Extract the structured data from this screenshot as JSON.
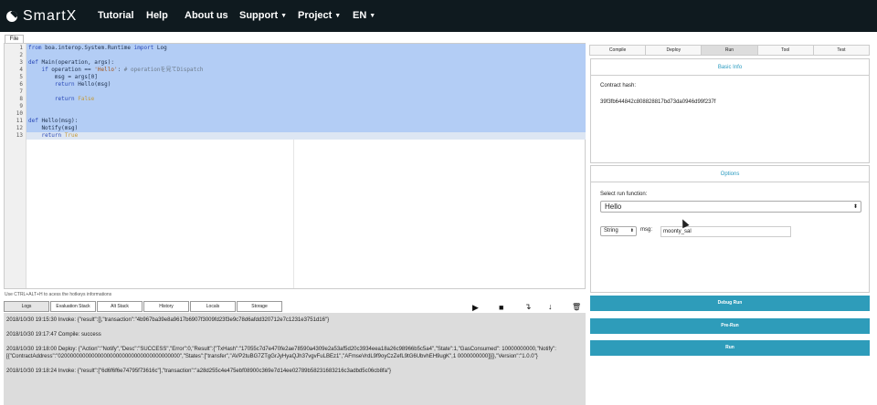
{
  "nav": {
    "brand": "SmartX",
    "items": [
      "Tutorial",
      "Help",
      "About us",
      "Support",
      "Project",
      "EN"
    ]
  },
  "editor": {
    "file_tab": "File",
    "hint": "Use CTRL+ALT+H to acess the hotkeys informations",
    "lines": [
      {
        "n": "1",
        "text": ""
      },
      {
        "n": "2",
        "text": ""
      },
      {
        "n": "3",
        "text": ""
      },
      {
        "n": "4",
        "text": ""
      },
      {
        "n": "5",
        "text": ""
      },
      {
        "n": "6",
        "text": ""
      },
      {
        "n": "7",
        "text": ""
      },
      {
        "n": "8",
        "text": ""
      },
      {
        "n": "9",
        "text": ""
      },
      {
        "n": "10",
        "text": ""
      },
      {
        "n": "11",
        "text": ""
      },
      {
        "n": "12",
        "text": ""
      },
      {
        "n": "13",
        "text": ""
      }
    ]
  },
  "bottom_tabs": [
    "Logs",
    "Evaluation Stack",
    "Alt Stack",
    "History",
    "Locals",
    "Storage"
  ],
  "console": [
    "2018/10/30 19:15:30 Invoke: {\"result\":[],\"transaction\":\"4b967ba39e8a9617b6907f3009fd23f3e9c78d6afdd320712e7c1231e3751d16\"}",
    "2018/10/30 19:17:47 Compile: success",
    "2018/10/30 19:18:00 Deploy: {\"Action\":\"Notify\",\"Desc\":\"SUCCESS\",\"Error\":0,\"Result\":{\"TxHash\":\"17055c7d7e470fe2ae78590a4309e2a53af5d20c3934eea18a26c98966b5c5a4\",\"State\":1,\"GasConsumed\": 10000000000,\"Notify\":[{\"ContractAddress\":\"0200000000000000000000000000000000000000\",\"States\":[\"transfer\",\"AVP2tuBG7ZTgGrJyHyaQJh37vgvFuLBEz1\",\"AFmseVrdL9f9oyCzZefL9tG6UbvhEH9ugK\",1 0000000000]}]},\"Version\":\"1.0.0\"}",
    "2018/10/30 19:18:24 Invoke: {\"result\":[\"6d6f6f6e74795f73616c\"],\"transaction\":\"a28d255c4e475ebf08900c369e7d14ee02789b58231683216c3adbd5c06cb8fa\"}"
  ],
  "right": {
    "tabs": [
      "Compile",
      "Deploy",
      "Run",
      "Tool",
      "Test"
    ],
    "active_tab": "Run",
    "basic_info": {
      "title": "Basic Info",
      "hash_label": "Contract hash:",
      "hash_value": "39f3fb644842c808828817bd73da0946d99f237f"
    },
    "options": {
      "title": "Options",
      "function_label": "Select run function:",
      "function_value": "Hello",
      "param_type": "String",
      "param_label": "msg:",
      "param_value": "moonty_sal"
    },
    "buttons": [
      "Debug Run",
      "Pre-Run",
      "Run"
    ]
  },
  "colors": {
    "nav_bg": "#0f1a1f",
    "accent": "#2e9cba",
    "selection": "#b3cdf5"
  }
}
